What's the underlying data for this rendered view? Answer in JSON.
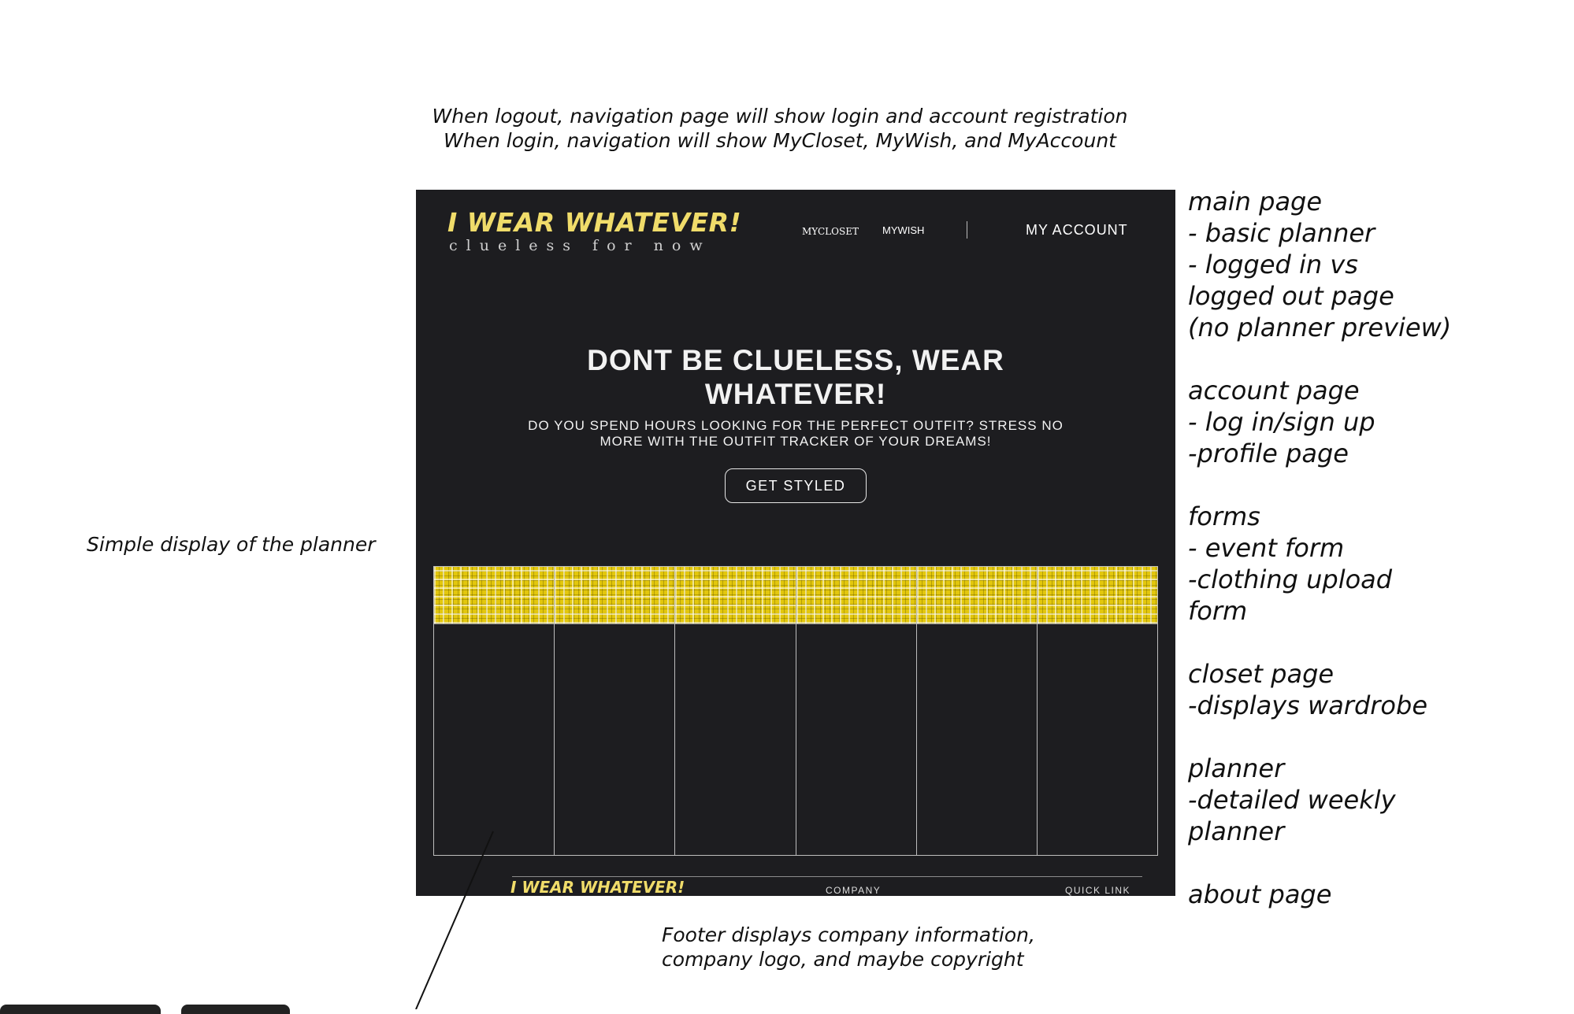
{
  "annotations": {
    "top": "When logout, navigation page will show login and account registration\nWhen login, navigation will show MyCloset, MyWish, and MyAccount",
    "planner": "Simple display of the planner",
    "footer": "Footer displays company information,\ncompany logo, and maybe copyright",
    "pages": "main page\n- basic planner\n- logged in vs\nlogged out page\n(no planner preview)\n\naccount page\n- log in/sign up\n-profile page\n\nforms\n- event form\n-clothing upload\nform\n\ncloset page\n-displays wardrobe\n\nplanner\n-detailed weekly\nplanner\n\nabout page"
  },
  "header": {
    "logo_title": "I WEAR WHATEVER!",
    "logo_tagline": "clueless for now",
    "nav": {
      "mycloset": "MYCLOSET",
      "mywish": "MYWISH",
      "account": "MY ACCOUNT"
    }
  },
  "hero": {
    "title": "DONT BE CLUELESS, WEAR WHATEVER!",
    "subtitle": "DO YOU SPEND HOURS LOOKING FOR THE PERFECT OUTFIT? STRESS NO MORE WITH THE OUTFIT TRACKER OF YOUR DREAMS!",
    "cta": "GET STYLED"
  },
  "planner": {
    "columns": 6
  },
  "footer": {
    "logo": "I WEAR WHATEVER!",
    "company": "COMPANY",
    "quick_link": "QUICK LINK"
  },
  "colors": {
    "background": "#1d1d20",
    "accent": "#f0dc6a",
    "plaid": "#e3c70d",
    "text": "#f2f2f2"
  }
}
